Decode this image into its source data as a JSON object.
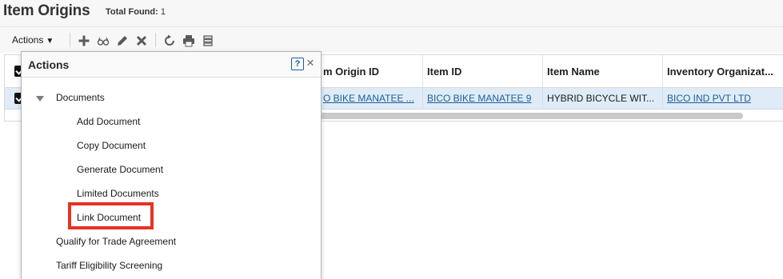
{
  "header": {
    "title": "Item Origins",
    "total_label": "Total Found:",
    "total_value": "1"
  },
  "toolbar": {
    "actions_label": "Actions",
    "icons": [
      "add-icon",
      "view-icon",
      "edit-icon",
      "delete-icon",
      "refresh-icon",
      "print-icon",
      "columns-icon"
    ]
  },
  "table": {
    "columns": [
      "m Origin ID",
      "Item ID",
      "Item Name",
      "Inventory Organizat..."
    ],
    "rows": [
      {
        "origin_id": "O BIKE MANATEE ...",
        "item_id": "BICO BIKE MANATEE 9",
        "item_name": "HYBRID BICYCLE WIT...",
        "inventory_org": "BICO IND PVT LTD"
      }
    ]
  },
  "popup": {
    "title": "Actions",
    "help_label": "?",
    "close_label": "×",
    "group_label": "Documents",
    "sub_items": [
      "Add Document",
      "Copy Document",
      "Generate Document",
      "Limited Documents",
      "Link Document"
    ],
    "top_items": [
      "Qualify for Trade Agreement",
      "Tariff Eligibility Screening"
    ]
  },
  "colors": {
    "highlight": "#e63323",
    "selected_row": "#dfecf7",
    "link": "#1e5b9a"
  }
}
